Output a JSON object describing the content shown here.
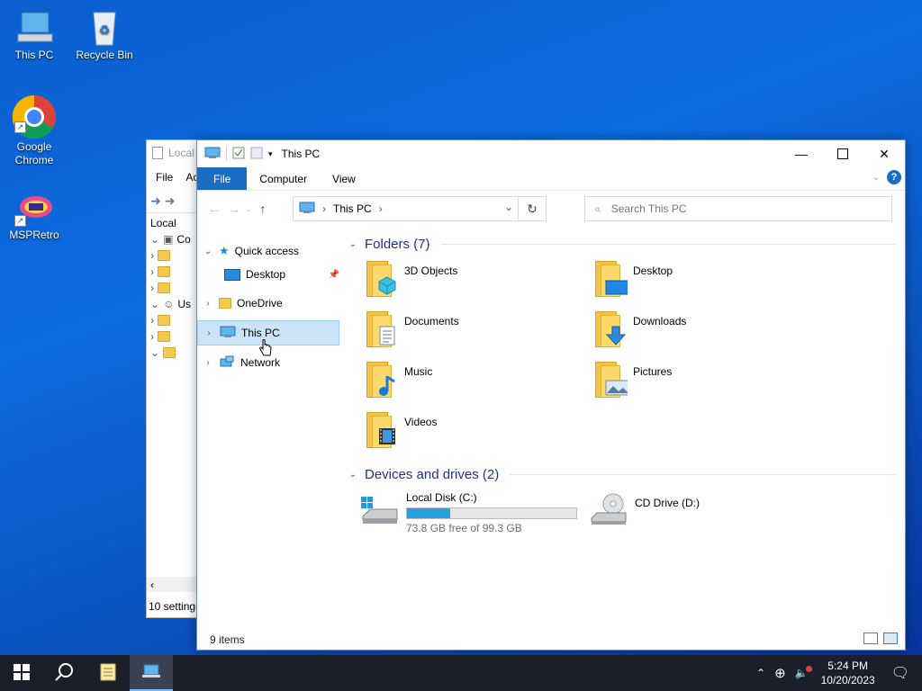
{
  "desktop": {
    "icons": [
      {
        "label": "This PC",
        "icon": "computer-icon"
      },
      {
        "label": "Recycle Bin",
        "icon": "recycle-bin-icon"
      },
      {
        "label": "Google Chrome",
        "label_line1": "Google",
        "label_line2": "Chrome",
        "icon": "chrome-icon"
      },
      {
        "label": "MSPRetro",
        "icon": "msp-retro-icon"
      }
    ]
  },
  "back_window": {
    "title": "Local",
    "menu": [
      "File",
      "Ac"
    ],
    "breadcrumb": "Local",
    "tree": [
      "Co",
      "Us"
    ],
    "status": "10 setting("
  },
  "window": {
    "title": "This PC",
    "ribbon_tabs": [
      "File",
      "Computer",
      "View"
    ],
    "help_label": "?",
    "address": {
      "crumb": "This PC"
    },
    "search": {
      "placeholder": "Search This PC"
    },
    "nav": {
      "quick_access": "Quick access",
      "desktop": "Desktop",
      "onedrive": "OneDrive",
      "this_pc": "This PC",
      "network": "Network"
    },
    "folders_header": "Folders (7)",
    "folders": [
      {
        "name": "3D Objects",
        "icon": "3d-objects-icon"
      },
      {
        "name": "Desktop",
        "icon": "desktop-folder-icon"
      },
      {
        "name": "Documents",
        "icon": "documents-icon"
      },
      {
        "name": "Downloads",
        "icon": "downloads-icon"
      },
      {
        "name": "Music",
        "icon": "music-icon"
      },
      {
        "name": "Pictures",
        "icon": "pictures-icon"
      },
      {
        "name": "Videos",
        "icon": "videos-icon"
      }
    ],
    "drives_header": "Devices and drives (2)",
    "drives": [
      {
        "name": "Local Disk (C:)",
        "free_text": "73.8 GB free of 99.3 GB",
        "used_fraction": 0.257,
        "icon": "hard-disk-icon"
      },
      {
        "name": "CD Drive (D:)",
        "icon": "cd-drive-icon"
      }
    ],
    "status": "9 items"
  },
  "taskbar": {
    "time": "5:24 PM",
    "date": "10/20/2023"
  },
  "colors": {
    "accent": "#1a6dc3",
    "selection": "#cce4f7",
    "drive_bar": "#26a0da",
    "group_header": "#1e3287"
  }
}
